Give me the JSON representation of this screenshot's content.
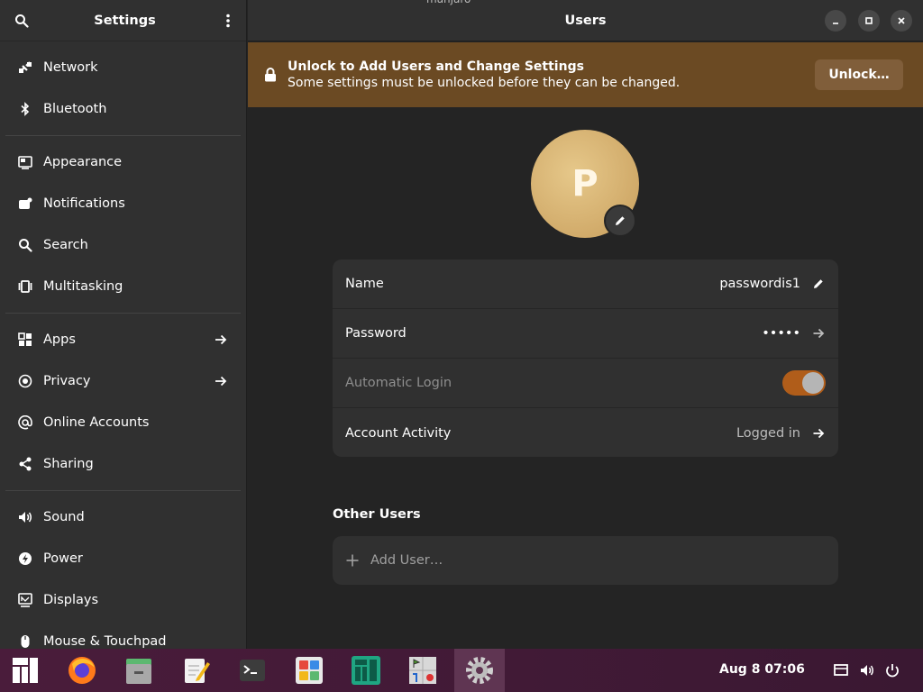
{
  "sidebar": {
    "title": "Settings",
    "groups": [
      [
        {
          "label": "Network",
          "icon": "network-icon"
        },
        {
          "label": "Bluetooth",
          "icon": "bluetooth-icon"
        }
      ],
      [
        {
          "label": "Appearance",
          "icon": "appearance-icon"
        },
        {
          "label": "Notifications",
          "icon": "notifications-icon"
        },
        {
          "label": "Search",
          "icon": "search-icon"
        },
        {
          "label": "Multitasking",
          "icon": "multitasking-icon"
        }
      ],
      [
        {
          "label": "Apps",
          "icon": "apps-icon",
          "arrow": true
        },
        {
          "label": "Privacy",
          "icon": "privacy-icon",
          "arrow": true
        },
        {
          "label": "Online Accounts",
          "icon": "online-accounts-icon"
        },
        {
          "label": "Sharing",
          "icon": "sharing-icon"
        }
      ],
      [
        {
          "label": "Sound",
          "icon": "sound-icon"
        },
        {
          "label": "Power",
          "icon": "power-icon"
        },
        {
          "label": "Displays",
          "icon": "displays-icon"
        },
        {
          "label": "Mouse & Touchpad",
          "icon": "mouse-icon"
        }
      ]
    ]
  },
  "header": {
    "title": "Users",
    "overlay_text": "manjaro"
  },
  "unlock": {
    "title": "Unlock to Add Users and Change Settings",
    "description": "Some settings must be unlocked before they can be changed.",
    "button_label": "Unlock…"
  },
  "user": {
    "avatar_letter": "P",
    "name_label": "Name",
    "name_value": "passwordis1",
    "password_label": "Password",
    "password_value": "•••••",
    "auto_login_label": "Automatic Login",
    "auto_login_enabled": true,
    "activity_label": "Account Activity",
    "activity_value": "Logged in"
  },
  "other_users": {
    "title": "Other Users",
    "add_label": "Add User…"
  },
  "taskbar": {
    "clock": "Aug 8  07:06",
    "apps": [
      "manjaro-menu-icon",
      "firefox-icon",
      "files-icon",
      "text-editor-icon",
      "terminal-icon",
      "software-icon",
      "manjaro-hello-icon",
      "mines-icon",
      "settings-icon"
    ]
  },
  "colors": {
    "accent": "#b05d1a",
    "banner": "#6b4a23",
    "taskbar": "#4a1c3b"
  }
}
